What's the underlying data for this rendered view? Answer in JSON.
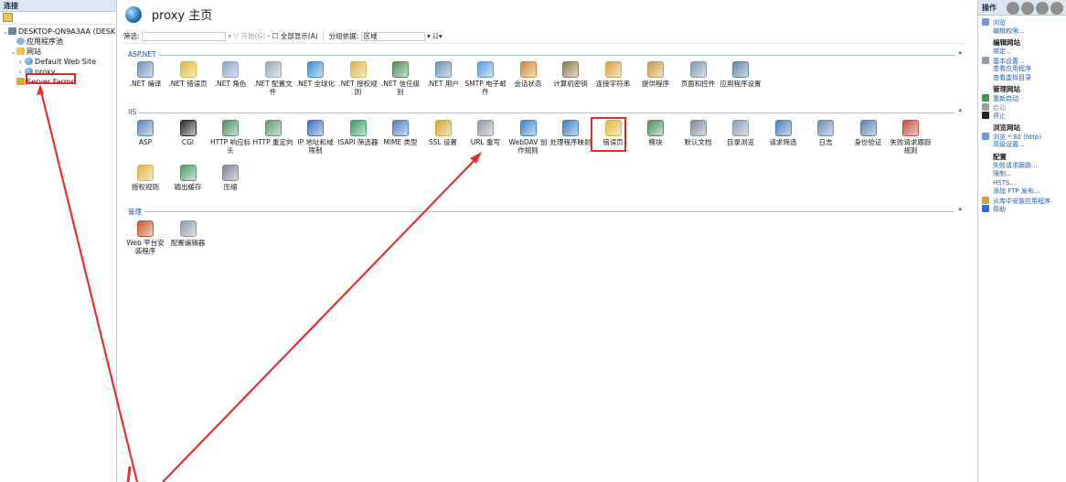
{
  "connections": {
    "header": "连接",
    "tree": [
      {
        "label": "DESKTOP-QN9A3AA (DESK",
        "depth": 0,
        "twisty": "⌄",
        "icon": "server-icon"
      },
      {
        "label": "应用程序池",
        "depth": 1,
        "twisty": "",
        "icon": "app-pool-icon"
      },
      {
        "label": "网站",
        "depth": 1,
        "twisty": "⌄",
        "icon": "sites-folder-icon"
      },
      {
        "label": "Default Web Site",
        "depth": 2,
        "twisty": "›",
        "icon": "globe-icon"
      },
      {
        "label": "proxy",
        "depth": 2,
        "twisty": "›",
        "icon": "globe-icon"
      },
      {
        "label": "Server Farms",
        "depth": 1,
        "twisty": "",
        "icon": "server-farms-icon"
      }
    ]
  },
  "center": {
    "title": "proxy 主页",
    "filter": {
      "label": "筛选:",
      "go": "▾ ▽ 开始(G)",
      "show_all": "- ☐ 全部显示(A)",
      "group_by_label": "分组依据:",
      "group_by_value": "区域",
      "view": "▾ ☷▾"
    },
    "sections": [
      {
        "label": "ASP.NET",
        "features": [
          {
            "label": ".NET 编译",
            "color": "#6f8fb8"
          },
          {
            "label": ".NET 错误页",
            "color": "#e0b838"
          },
          {
            "label": ".NET 角色",
            "color": "#8aa4c4"
          },
          {
            "label": ".NET 配置文件",
            "color": "#9aa7b5"
          },
          {
            "label": ".NET 全球化",
            "color": "#3e8fd0"
          },
          {
            "label": ".NET 授权规则",
            "color": "#d9b34a"
          },
          {
            "label": ".NET 信任级别",
            "color": "#4f8a52"
          },
          {
            "label": ".NET 用户",
            "color": "#6d8fb5"
          },
          {
            "label": "SMTP 电子邮件",
            "color": "#5b9bd3"
          },
          {
            "label": "会话状态",
            "color": "#c98b3a"
          },
          {
            "label": "计算机密钥",
            "color": "#8c7a52"
          },
          {
            "label": "连接字符串",
            "color": "#d8a340"
          },
          {
            "label": "提供程序",
            "color": "#c49a4a"
          },
          {
            "label": "页面和控件",
            "color": "#7f96b3"
          },
          {
            "label": "应用程序设置",
            "color": "#5f85b0"
          }
        ]
      },
      {
        "label": "IIS",
        "features": [
          {
            "label": "ASP",
            "color": "#5c86b4"
          },
          {
            "label": "CGI",
            "color": "#2b2b2b"
          },
          {
            "label": "HTTP 响应标头",
            "color": "#4a8e62"
          },
          {
            "label": "HTTP 重定向",
            "color": "#5e9a72"
          },
          {
            "label": "IP 地址和域限制",
            "color": "#3c70c0"
          },
          {
            "label": "ISAPI 筛选器",
            "color": "#3a9a6a"
          },
          {
            "label": "MIME 类型",
            "color": "#4e7fbf"
          },
          {
            "label": "SSL 设置",
            "color": "#d2a63a"
          },
          {
            "label": "URL 重写",
            "color": "#8e9aa8"
          },
          {
            "label": "WebDAV 创作规则",
            "color": "#3b83c8"
          },
          {
            "label": "处理程序映射",
            "color": "#3e7cc0"
          },
          {
            "label": "错误页",
            "color": "#e0b838"
          },
          {
            "label": "模块",
            "color": "#4b8f5d"
          },
          {
            "label": "默认文档",
            "color": "#7c8a9a"
          },
          {
            "label": "目录浏览",
            "color": "#8a9bb0"
          },
          {
            "label": "请求筛选",
            "color": "#4c7fb8"
          },
          {
            "label": "日志",
            "color": "#6b8bb5"
          },
          {
            "label": "身份验证",
            "color": "#5a7fa8"
          },
          {
            "label": "失败请求跟踪规则",
            "color": "#c24a3a"
          },
          {
            "label": "授权规则",
            "color": "#d9b34a"
          },
          {
            "label": "输出缓存",
            "color": "#4f9a6a"
          },
          {
            "label": "压缩",
            "color": "#7a8494"
          }
        ]
      },
      {
        "label": "管理",
        "features": [
          {
            "label": "Web 平台安装程序",
            "color": "#c8572a"
          },
          {
            "label": "配置编辑器",
            "color": "#8d99a8"
          }
        ]
      }
    ]
  },
  "actions": {
    "header": "操作",
    "items": [
      {
        "type": "action",
        "label": "浏览",
        "icon": "#6b9ad6"
      },
      {
        "type": "action",
        "label": "编辑权限..."
      },
      {
        "type": "heading",
        "label": "编辑网站"
      },
      {
        "type": "action",
        "label": "绑定..."
      },
      {
        "type": "action",
        "label": "基本设置...",
        "icon": "#8a9bb0"
      },
      {
        "type": "action",
        "label": "查看应用程序"
      },
      {
        "type": "action",
        "label": "查看虚拟目录"
      },
      {
        "type": "heading",
        "label": "管理网站"
      },
      {
        "type": "action",
        "label": "重新启动",
        "icon": "#3f9a4f"
      },
      {
        "type": "disabled",
        "label": "启动",
        "icon": "#a0a0a0"
      },
      {
        "type": "action",
        "label": "停止",
        "icon": "#222222"
      },
      {
        "type": "heading",
        "label": "浏览网站"
      },
      {
        "type": "action",
        "label": "浏览 *:80 (http)",
        "icon": "#6b9ad6"
      },
      {
        "type": "action",
        "label": "高级设置..."
      },
      {
        "type": "heading",
        "label": "配置"
      },
      {
        "type": "action",
        "label": "失败请求跟踪..."
      },
      {
        "type": "action",
        "label": "限制..."
      },
      {
        "type": "action",
        "label": "HSTS..."
      },
      {
        "type": "action",
        "label": "添加 FTP 发布..."
      },
      {
        "type": "action",
        "label": "从库中安装应用程序",
        "icon": "#d5a24a"
      },
      {
        "type": "action",
        "label": "帮助",
        "icon": "#2f6fc8"
      }
    ]
  }
}
